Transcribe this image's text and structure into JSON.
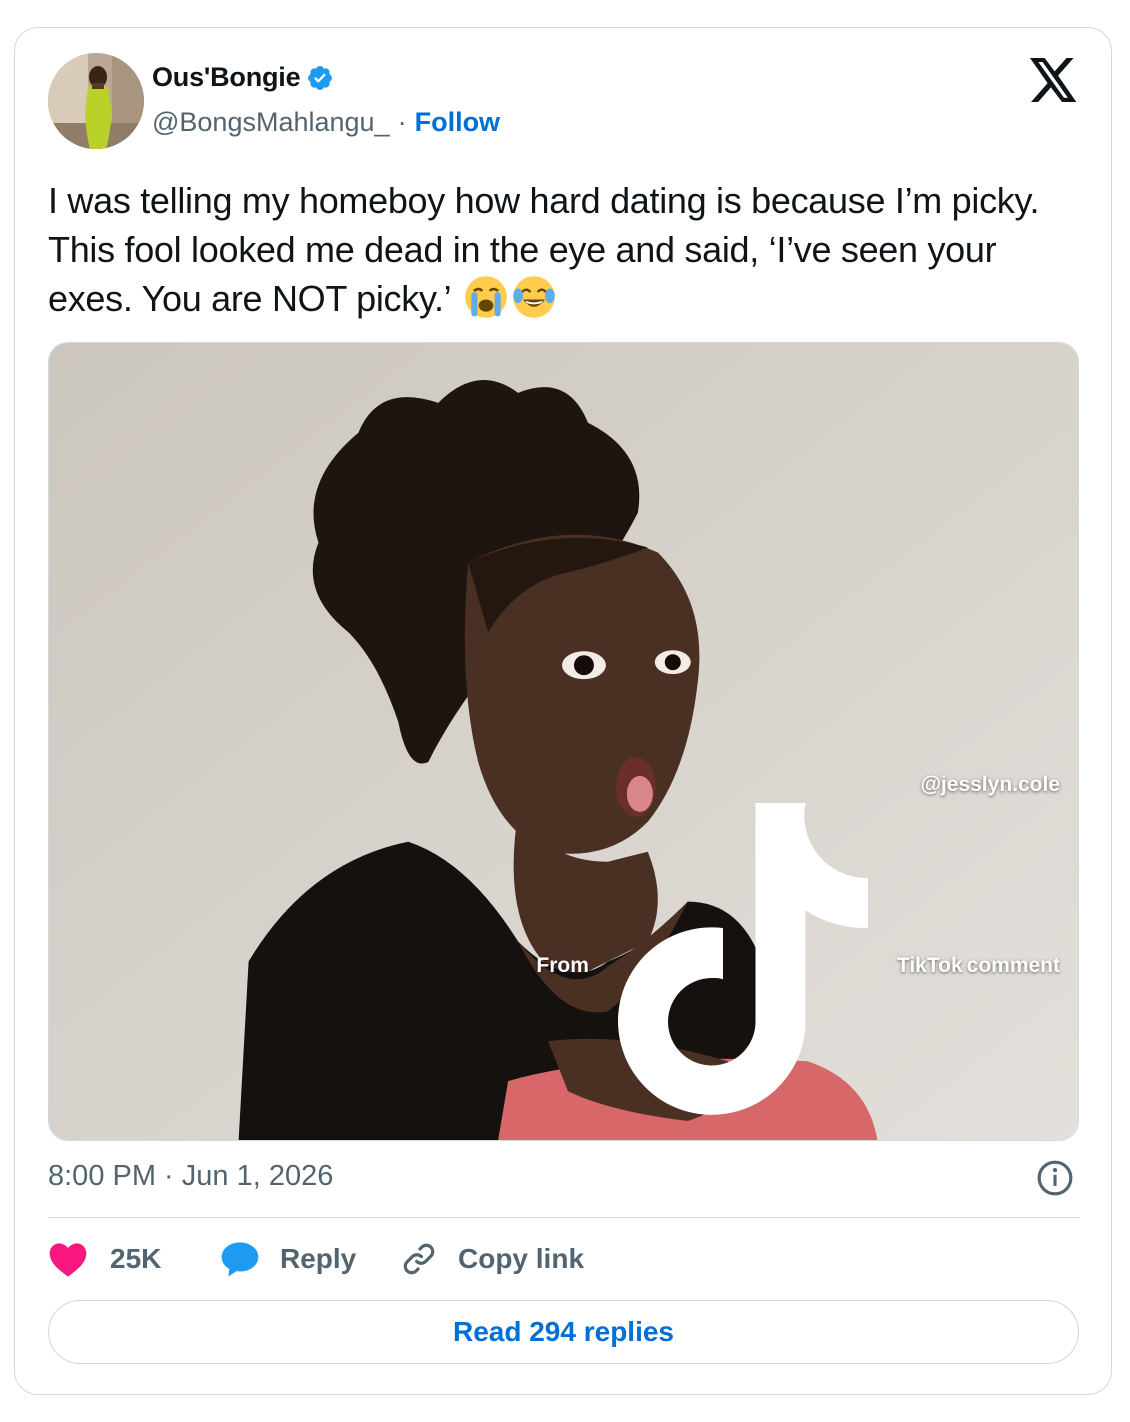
{
  "author": {
    "display_name": "Ous'Bongie",
    "handle": "@BongsMahlangu_",
    "separator": "·",
    "follow_label": "Follow",
    "verified_color": "#1d9bf0"
  },
  "tweet": {
    "text": "I was telling my homeboy how hard dating is because I’m picky. This fool looked me dead in the eye and said, ‘I’ve seen your exes. You are NOT picky.’",
    "emojis": [
      "loudly-crying-face",
      "face-with-tears-of-joy"
    ]
  },
  "media": {
    "watermark_user": "@jesslyn.cole",
    "watermark_prefix": "From",
    "watermark_brand": "TikTok",
    "watermark_suffix": "comment"
  },
  "timestamp": "8:00 PM · Jun 1, 2026",
  "actions": {
    "likes": "25K",
    "reply_label": "Reply",
    "copy_label": "Copy link"
  },
  "read_replies_label": "Read 294 replies",
  "colors": {
    "accent_link": "#006fd6",
    "heart": "#f91880",
    "reply_bubble": "#1d9bf0",
    "muted_text": "#536471",
    "border": "#cfd9de"
  }
}
